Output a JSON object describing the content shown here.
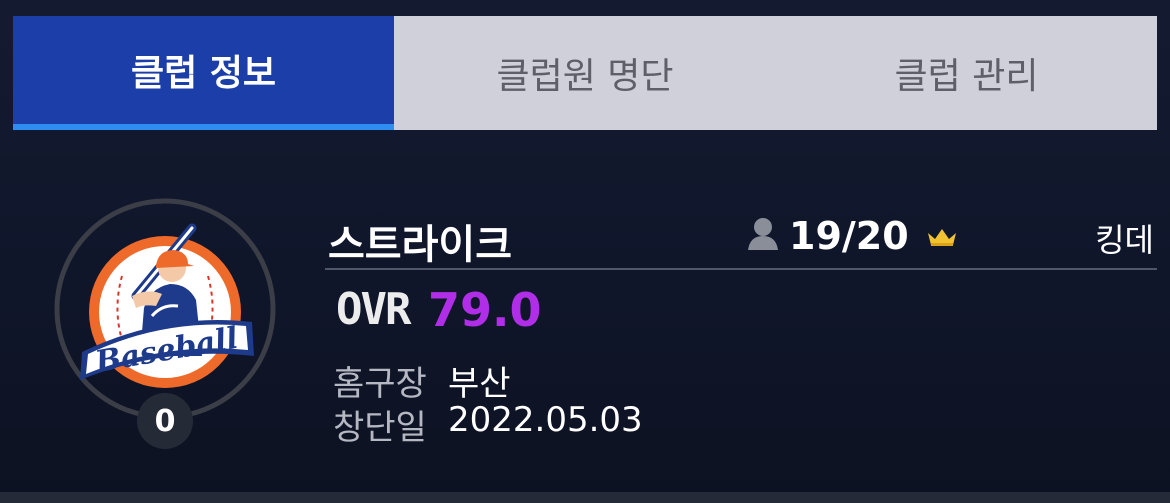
{
  "tabs": {
    "club_info": "클럽 정보",
    "members": "클럽원 명단",
    "manage": "클럽 관리"
  },
  "club": {
    "name": "스트라이크",
    "member_count": "19/20",
    "leader": "킹데",
    "ovr_label": "OVR",
    "ovr_value": "79.0",
    "level": "0",
    "home_label": "홈구장",
    "home_value": "부산",
    "founded_label": "창단일",
    "founded_value": "2022.05.03",
    "emblem_text": "Baseball"
  },
  "colors": {
    "active_tab": "#1c3ea8",
    "active_tab_underline": "#2f8df2",
    "inactive_tab": "#cfd0da",
    "ovr_value": "#b02ee8",
    "crown": "#f1c232",
    "emblem_orange": "#ee6a2a",
    "emblem_blue": "#1e3a8a"
  },
  "icons": {
    "member": "person-silhouette-icon",
    "leader": "crown-icon",
    "emblem": "baseball-batter-emblem"
  }
}
